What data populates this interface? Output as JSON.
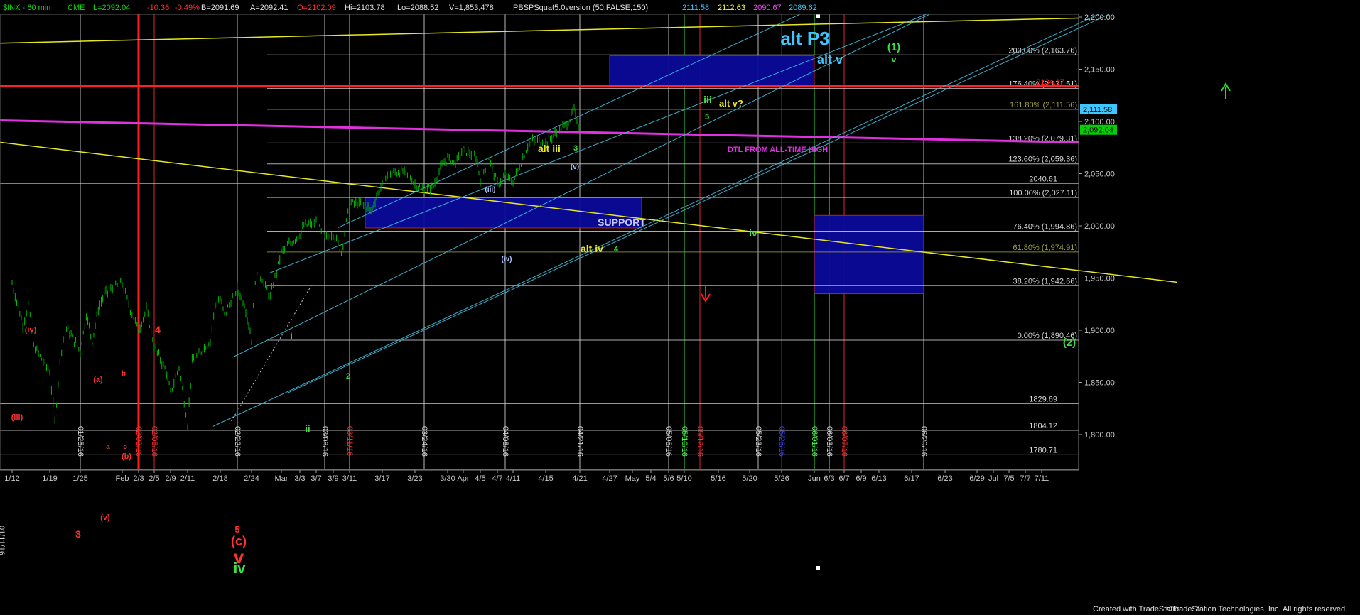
{
  "header": {
    "symbol": "$INX - 60 min",
    "exchange": "CME",
    "last": "L=2092.04",
    "change": "-10.36",
    "change_pct": "-0.49%",
    "bid": "B=2091.69",
    "ask": "A=2092.41",
    "open": "O=2102.09",
    "high": "Hi=2103.78",
    "low": "Lo=2088.52",
    "volume": "V=1,853,478",
    "study": "PBSPSquat5.0version (50,FALSE,150)",
    "study_values": [
      {
        "text": "2111.58",
        "color": "#3ec7ff"
      },
      {
        "text": "2112.63",
        "color": "#ffff40"
      },
      {
        "text": "2090.67",
        "color": "#ff40ff"
      },
      {
        "text": "2089.62",
        "color": "#3ec7ff"
      }
    ]
  },
  "footer": {
    "created": "Created with TradeStation.",
    "copyright": "©TradeStation Technologies, Inc. All rights reserved."
  },
  "colors": {
    "background": "#000000",
    "bars": "#00c000",
    "fib_white": "#d8d8d8",
    "fib_olive": "#a0a040",
    "channel": "#40c0e0",
    "dtl": "#e030e0",
    "yellow_line": "#e8e820",
    "red_line": "#ff2020",
    "box_fill": "#0a0a9a"
  },
  "chart_data": {
    "type": "candlestick-ohlc",
    "interval": "60 min",
    "ylim": [
      1770,
      2215
    ],
    "y_ticks": [
      "2,200.00",
      "2,150.00",
      "2,100.00",
      "2,050.00",
      "2,000.00",
      "1,950.00",
      "1,900.00",
      "1,850.00",
      "1,800.00"
    ],
    "x_ticks": [
      "1/12",
      "1/19",
      "1/25",
      "Feb",
      "2/3",
      "2/5",
      "2/9",
      "2/11",
      "2/18",
      "2/24",
      "Mar",
      "3/3",
      "3/7",
      "3/9",
      "3/11",
      "3/17",
      "3/23",
      "3/30",
      "Apr",
      "4/5",
      "4/7",
      "4/11",
      "4/15",
      "4/21",
      "4/27",
      "May",
      "5/4",
      "5/6",
      "5/10",
      "5/16",
      "5/20",
      "5/26",
      "Jun",
      "6/3",
      "6/7",
      "6/9",
      "6/13",
      "6/17",
      "6/23",
      "6/29",
      "Jul",
      "7/5",
      "7/7",
      "7/11"
    ],
    "price_path": [
      [
        "1/12",
        1945
      ],
      [
        "1/14",
        1905
      ],
      [
        "1/15",
        1925
      ],
      [
        "1/16",
        1885
      ],
      [
        "1/19",
        1860
      ],
      [
        "1/20",
        1812
      ],
      [
        "1/21",
        1870
      ],
      [
        "1/22",
        1905
      ],
      [
        "1/25",
        1880
      ],
      [
        "1/26",
        1915
      ],
      [
        "1/27",
        1890
      ],
      [
        "1/28",
        1920
      ],
      [
        "1/29",
        1935
      ],
      [
        "2/1",
        1945
      ],
      [
        "2/2",
        1920
      ],
      [
        "2/3",
        1900
      ],
      [
        "2/4",
        1920
      ],
      [
        "2/5",
        1885
      ],
      [
        "2/8",
        1860
      ],
      [
        "2/9",
        1840
      ],
      [
        "2/10",
        1865
      ],
      [
        "2/11",
        1810
      ],
      [
        "2/12",
        1870
      ],
      [
        "2/16",
        1890
      ],
      [
        "2/17",
        1925
      ],
      [
        "2/18",
        1930
      ],
      [
        "2/19",
        1915
      ],
      [
        "2/22",
        1940
      ],
      [
        "2/23",
        1925
      ],
      [
        "2/24",
        1892
      ],
      [
        "2/25",
        1948
      ],
      [
        "2/26",
        1955
      ],
      [
        "2/29",
        1932
      ],
      [
        "3/1",
        1975
      ],
      [
        "3/3",
        1992
      ],
      [
        "3/4",
        2000
      ],
      [
        "3/7",
        2003
      ],
      [
        "3/8",
        1988
      ],
      [
        "3/9",
        1993
      ],
      [
        "3/10",
        1975
      ],
      [
        "3/11",
        2022
      ],
      [
        "3/14",
        2020
      ],
      [
        "3/15",
        2014
      ],
      [
        "3/16",
        2028
      ],
      [
        "3/17",
        2040
      ],
      [
        "3/18",
        2050
      ],
      [
        "3/21",
        2052
      ],
      [
        "3/22",
        2048
      ],
      [
        "3/23",
        2040
      ],
      [
        "3/24",
        2035
      ],
      [
        "3/28",
        2038
      ],
      [
        "3/29",
        2055
      ],
      [
        "3/30",
        2065
      ],
      [
        "3/31",
        2060
      ],
      [
        "4/1",
        2073
      ],
      [
        "4/4",
        2066
      ],
      [
        "4/5",
        2045
      ],
      [
        "4/6",
        2065
      ],
      [
        "4/7",
        2040
      ],
      [
        "4/8",
        2048
      ],
      [
        "4/11",
        2042
      ],
      [
        "4/12",
        2061
      ],
      [
        "4/13",
        2080
      ],
      [
        "4/14",
        2082
      ],
      [
        "4/15",
        2080
      ],
      [
        "4/18",
        2094
      ],
      [
        "4/19",
        2100
      ],
      [
        "4/20",
        2111
      ],
      [
        "4/21",
        2092
      ]
    ],
    "fib_levels": [
      {
        "label": "200.00% (2,163.76)",
        "value": 2163.76
      },
      {
        "label": "176.40% (2,131.51)",
        "value": 2131.51
      },
      {
        "label": "161.80% (2,111.56)",
        "value": 2111.56
      },
      {
        "label": "138.20% (2,079.31)",
        "value": 2079.31
      },
      {
        "label": "123.60% (2,059.36)",
        "value": 2059.36
      },
      {
        "label": "100.00% (2,027.11)",
        "value": 2027.11
      },
      {
        "label": "76.40% (1,994.86)",
        "value": 1994.86
      },
      {
        "label": "61.80% (1,974.91)",
        "value": 1974.91
      },
      {
        "label": "38.20% (1,942.66)",
        "value": 1942.66
      },
      {
        "label": "0.00% (1,890.46)",
        "value": 1890.46
      }
    ],
    "horizontal_levels": [
      {
        "label": "2040.61",
        "value": 2040.61
      },
      {
        "label": "1829.69",
        "value": 1829.69
      },
      {
        "label": "1804.12",
        "value": 1804.12
      },
      {
        "label": "1780.71",
        "value": 1780.71
      }
    ],
    "red_level": {
      "label": "2134.17",
      "value": 2134.17
    },
    "price_markers": [
      {
        "label": "2,111.58",
        "value": 2111.58,
        "color": "#3ec7ff"
      },
      {
        "label": "2,092.04",
        "value": 2092.04,
        "color": "#00d000"
      }
    ],
    "dated_verticals": [
      {
        "label": "01/25/16",
        "x": "1/25",
        "color": "#d8d8d8"
      },
      {
        "label": "02/03/16",
        "x": "2/3",
        "color": "#ff3030"
      },
      {
        "label": "02/05/16",
        "x": "2/5",
        "color": "#ff3030"
      },
      {
        "label": "02/22/16",
        "x": "2/22",
        "color": "#d8d8d8"
      },
      {
        "label": "03/08/16",
        "x": "3/8",
        "color": "#d8d8d8"
      },
      {
        "label": "03/11/16",
        "x": "3/11",
        "color": "#ff3030"
      },
      {
        "label": "03/24/16",
        "x": "3/24",
        "color": "#d8d8d8"
      },
      {
        "label": "04/08/16",
        "x": "4/8",
        "color": "#d8d8d8"
      },
      {
        "label": "04/21/16",
        "x": "4/21",
        "color": "#d8d8d8"
      },
      {
        "label": "05/06/16",
        "x": "5/6",
        "color": "#d8d8d8"
      },
      {
        "label": "05/10/16",
        "x": "5/10",
        "color": "#40ff40"
      },
      {
        "label": "05/12/16",
        "x": "5/12",
        "color": "#ff3030"
      },
      {
        "label": "05/23/16",
        "x": "5/23",
        "color": "#d8d8d8"
      },
      {
        "label": "05/26/16",
        "x": "5/26",
        "color": "#4040ff"
      },
      {
        "label": "06/01/16",
        "x": "6/1",
        "color": "#40ff40"
      },
      {
        "label": "06/03/16",
        "x": "6/3",
        "color": "#d8d8d8"
      },
      {
        "label": "06/07/16",
        "x": "6/7",
        "color": "#ff3030"
      },
      {
        "label": "06/20/16",
        "x": "6/20",
        "color": "#d8d8d8"
      }
    ],
    "partial_left_date": "01/11/16",
    "boxes": [
      {
        "name": "support-box",
        "label": "SUPPORT",
        "x_from": "3/14",
        "x_to": "5/3",
        "y_from": 1998,
        "y_to": 2027
      },
      {
        "name": "target-box",
        "label": "",
        "x_from": "4/27",
        "x_to": "6/1",
        "y_from": 2134,
        "y_to": 2163
      },
      {
        "name": "wave2-box",
        "label": "",
        "x_from": "6/1",
        "x_to": "6/20",
        "y_from": 1935,
        "y_to": 2010
      }
    ],
    "annotations": [
      {
        "text": "alt  P3",
        "color": "#3ec7ff",
        "size": 26
      },
      {
        "text": "alt v",
        "color": "#3ec7ff",
        "size": 18
      },
      {
        "text": "(1)",
        "color": "#40e040",
        "size": 15
      },
      {
        "text": "v",
        "color": "#40e040",
        "size": 13
      },
      {
        "text": "iii",
        "color": "#40e040",
        "size": 14
      },
      {
        "text": "5",
        "color": "#40e040",
        "size": 11
      },
      {
        "text": "alt v?",
        "color": "#e8e820",
        "size": 13
      },
      {
        "text": "DTL FROM ALL-TIME HIGH",
        "color": "#e030e0",
        "size": 11
      },
      {
        "text": "alt iii",
        "color": "#e8e820",
        "size": 14
      },
      {
        "text": "3",
        "color": "#40e040",
        "size": 11
      },
      {
        "text": "(v)",
        "color": "#b0c8ff",
        "size": 10
      },
      {
        "text": "(iii)",
        "color": "#b0c8ff",
        "size": 10
      },
      {
        "text": "(iv)",
        "color": "#b0c8ff",
        "size": 10
      },
      {
        "text": "alt iv",
        "color": "#e8e820",
        "size": 14
      },
      {
        "text": "4",
        "color": "#40e040",
        "size": 11
      },
      {
        "text": "iv",
        "color": "#40e040",
        "size": 14
      },
      {
        "text": "i",
        "color": "#40e040",
        "size": 14
      },
      {
        "text": "ii",
        "color": "#40e040",
        "size": 13
      },
      {
        "text": "2",
        "color": "#40e040",
        "size": 11
      },
      {
        "text": "(2)",
        "color": "#40e040",
        "size": 15
      },
      {
        "text": "(iv)",
        "color": "#ff3030",
        "size": 11
      },
      {
        "text": "(iii)",
        "color": "#ff3030",
        "size": 11
      },
      {
        "text": "4",
        "color": "#ff3030",
        "size": 14
      },
      {
        "text": "(a)",
        "color": "#ff3030",
        "size": 11
      },
      {
        "text": "b",
        "color": "#ff3030",
        "size": 10
      },
      {
        "text": "a",
        "color": "#ff3030",
        "size": 10
      },
      {
        "text": "c",
        "color": "#ff3030",
        "size": 10
      },
      {
        "text": "(b)",
        "color": "#ff3030",
        "size": 11
      },
      {
        "text": "(v)",
        "color": "#ff3030",
        "size": 11
      },
      {
        "text": "3",
        "color": "#ff3030",
        "size": 14
      },
      {
        "text": "5",
        "color": "#ff3030",
        "size": 13
      },
      {
        "text": "(c)",
        "color": "#ff3030",
        "size": 18
      },
      {
        "text": "v",
        "color": "#ff3030",
        "size": 26
      },
      {
        "text": "iv",
        "color": "#40e040",
        "size": 20
      }
    ]
  }
}
